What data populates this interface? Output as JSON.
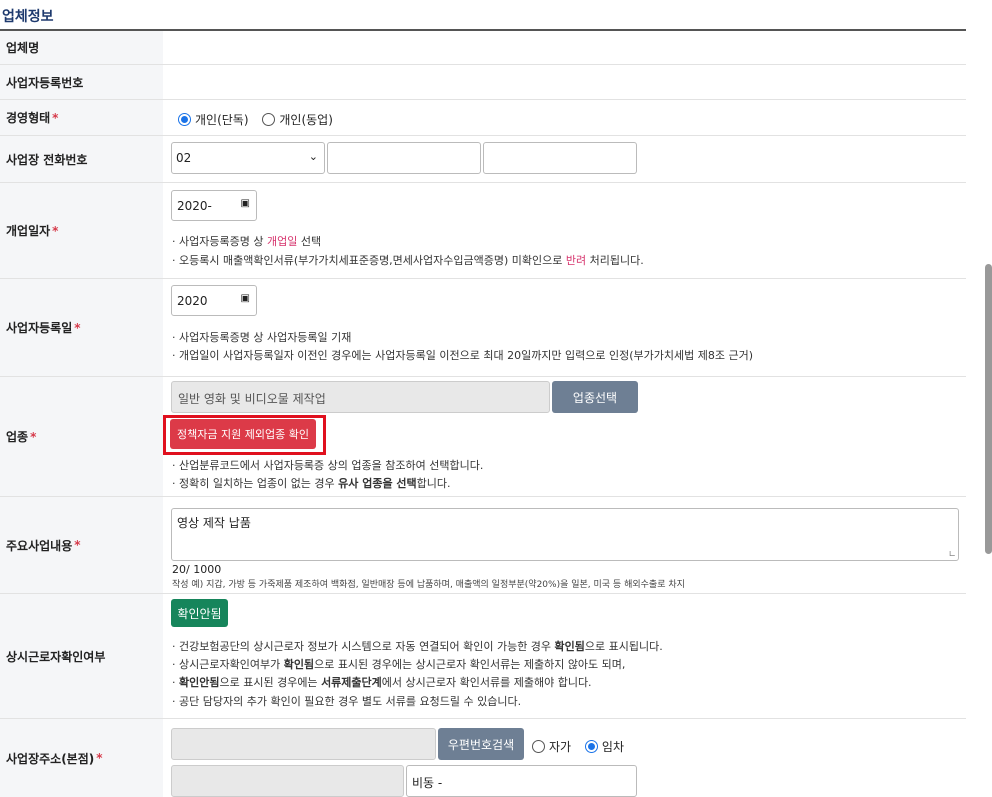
{
  "section_title": "업체정보",
  "rows": {
    "company_name": {
      "label": "업체명"
    },
    "biz_number": {
      "label": "사업자등록번호"
    },
    "biz_type": {
      "label": "경영형태",
      "required_mark": "*",
      "options": [
        "개인(단독)",
        "개인(동업)"
      ],
      "selected": "개인(단독)"
    },
    "phone": {
      "label": "사업장 전화번호",
      "area_code": "02",
      "part2": "",
      "part3": ""
    },
    "open_date": {
      "label": "개업일자",
      "required_mark": "*",
      "value": "2020-",
      "note1_a": "사업자등록증명 상 ",
      "note1_b": "개업일",
      "note1_c": " 선택",
      "note2_a": "오등록시 매출액확인서류(부가가치세표준증명,면세사업자수입금액증명) 미확인으로 ",
      "note2_b": "반려",
      "note2_c": " 처리됩니다."
    },
    "reg_date": {
      "label": "사업자등록일",
      "required_mark": "*",
      "value": "2020",
      "note1": "사업자등록증명 상 사업자등록일 기재",
      "note2": "개업일이 사업자등록일자 이전인 경우에는 사업자등록일 이전으로 최대 20일까지만 입력으로 인정(부가가치세법 제8조 근거)"
    },
    "industry": {
      "label": "업종",
      "required_mark": "*",
      "value": "일반 영화 및 비디오물 제작업",
      "select_button": "업종선택",
      "exclude_button": "정책자금 지원 제외업종 확인",
      "note1": "산업분류코드에서 사업자등록증 상의 업종을 참조하여 선택합니다.",
      "note2_a": "정확히 일치하는 업종이 없는 경우 ",
      "note2_b": "유사 업종을 선택",
      "note2_c": "합니다."
    },
    "main_business": {
      "label": "주요사업내용",
      "required_mark": "*",
      "value": "영상 제작 납품",
      "counter": "20/ 1000",
      "example": "작성 예) 지갑, 가방 등 가죽제품 제조하여 백화점, 일반매장 등에 납품하며, 매출액의 일정부분(약20%)을 일본, 미국 등 해외수출로 차지"
    },
    "employee_check": {
      "label": "상시근로자확인여부",
      "status_button": "확인안됨",
      "n1_a": "건강보험공단의 상시근로자 정보가 시스템으로 자동 연결되어 확인이 가능한 경우 ",
      "n1_b": "확인됨",
      "n1_c": "으로 표시됩니다.",
      "n2_a": "상시근로자확인여부가 ",
      "n2_b": "확인됨",
      "n2_c": "으로 표시된 경우에는 상시근로자 확인서류는 제출하지 않아도 되며,",
      "n3_a": "확인안됨",
      "n3_b": "으로 표시된 경우에는 ",
      "n3_c": "서류제출단계",
      "n3_d": "에서 상시근로자 확인서류를 제출해야 합니다.",
      "n4": "공단 담당자의 추가 확인이 필요한 경우 별도 서류를 요청드릴 수 있습니다."
    },
    "address": {
      "label": "사업장주소(본점)",
      "required_mark": "*",
      "zip_button": "우편번호검색",
      "options": [
        "자가",
        "임차"
      ],
      "selected": "임차",
      "detail_value": "비동 -"
    }
  }
}
